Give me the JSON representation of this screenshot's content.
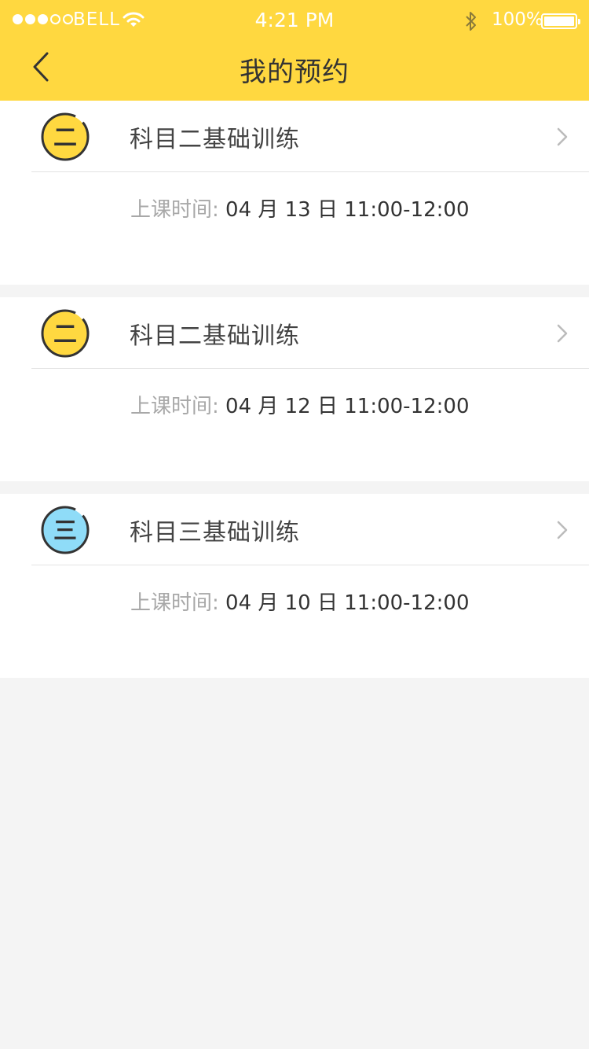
{
  "status_bar": {
    "carrier": "BELL",
    "time": "4:21 PM",
    "battery": "100%",
    "signal_filled": 3,
    "signal_total": 5
  },
  "nav": {
    "back_icon": "chevron-left-icon",
    "title": "我的预约"
  },
  "colors": {
    "header_bg": "#ffd840",
    "badge_yellow": "#ffd840",
    "badge_blue": "#8fdcf8",
    "page_bg": "#f4f4f4"
  },
  "appointments": [
    {
      "badge_char": "二",
      "badge_color": "#ffd840",
      "title": "科目二基础训练",
      "time_label": "上课时间:",
      "time_value": "04 月 13 日  11:00-12:00"
    },
    {
      "badge_char": "二",
      "badge_color": "#ffd840",
      "title": "科目二基础训练",
      "time_label": "上课时间:",
      "time_value": "04 月 12 日  11:00-12:00"
    },
    {
      "badge_char": "三",
      "badge_color": "#8fdcf8",
      "title": "科目三基础训练",
      "time_label": "上课时间:",
      "time_value": "04 月 10 日  11:00-12:00"
    }
  ]
}
